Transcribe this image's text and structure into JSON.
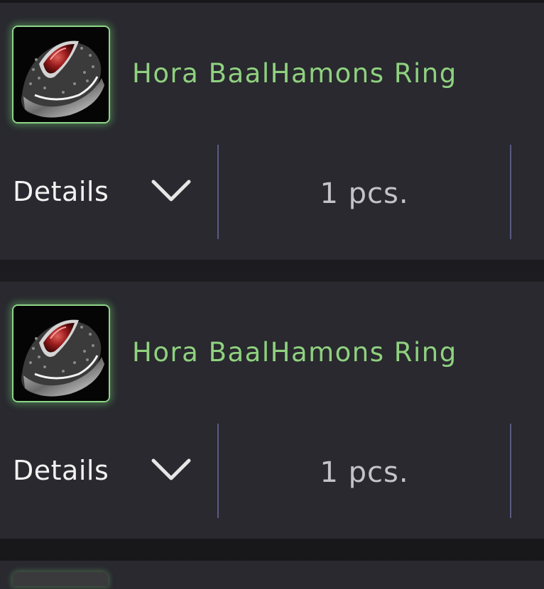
{
  "items": [
    {
      "name": "Hora BaalHamons Ring",
      "icon": "ring-icon",
      "details_label": "Details",
      "quantity": "1 pcs."
    },
    {
      "name": "Hora BaalHamons Ring",
      "icon": "ring-icon",
      "details_label": "Details",
      "quantity": "1 pcs."
    }
  ],
  "colors": {
    "item_name": "#8fd17f",
    "icon_glow": "#8fd48a",
    "card_background": "#29292f",
    "divider": "#5a5a82"
  }
}
